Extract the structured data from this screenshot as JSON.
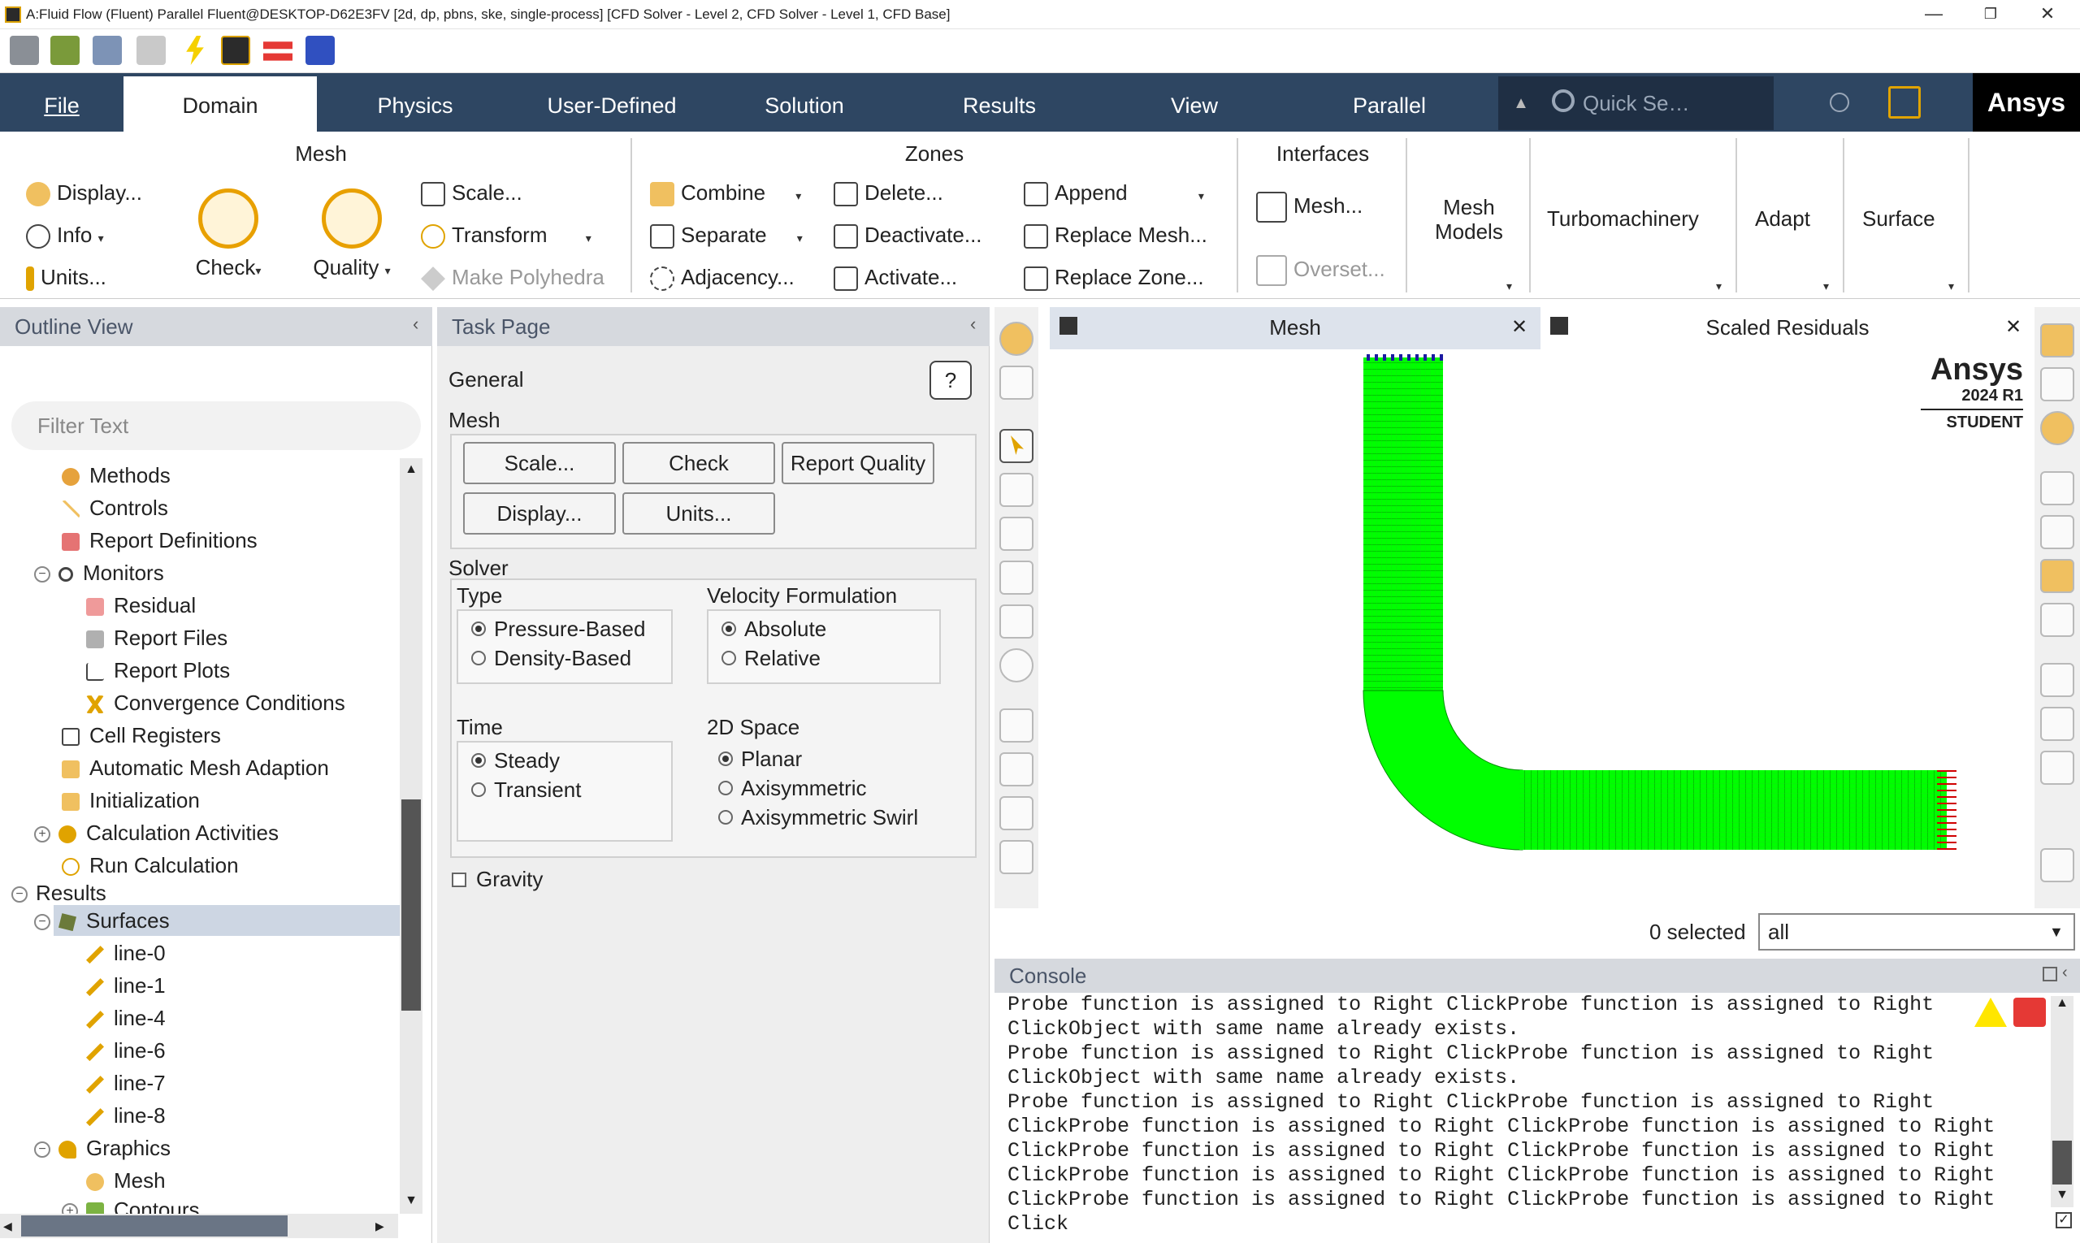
{
  "window": {
    "title": "A:Fluid Flow (Fluent) Parallel Fluent@DESKTOP-D62E3FV  [2d, dp, pbns, ske, single-process] [CFD Solver - Level 2, CFD Solver - Level 1, CFD Base]",
    "minimize": "—",
    "maximize": "❐",
    "close": "✕"
  },
  "tabs": [
    {
      "label": "File"
    },
    {
      "label": "Domain"
    },
    {
      "label": "Physics"
    },
    {
      "label": "User-Defined"
    },
    {
      "label": "Solution"
    },
    {
      "label": "Results"
    },
    {
      "label": "View"
    },
    {
      "label": "Parallel"
    }
  ],
  "quick_search": {
    "placeholder": "Quick Se…"
  },
  "brand": "Ansys",
  "ribbon": {
    "mesh": {
      "title": "Mesh",
      "display": "Display...",
      "info": "Info",
      "units": "Units...",
      "check": "Check",
      "quality": "Quality",
      "scale": "Scale...",
      "transform": "Transform",
      "make_polyhedra": "Make Polyhedra"
    },
    "zones": {
      "title": "Zones",
      "combine": "Combine",
      "separate": "Separate",
      "adjacency": "Adjacency...",
      "delete": "Delete...",
      "deactivate": "Deactivate...",
      "activate": "Activate...",
      "append": "Append",
      "replace_mesh": "Replace Mesh...",
      "replace_zone": "Replace Zone..."
    },
    "interfaces": {
      "title": "Interfaces",
      "mesh": "Mesh...",
      "overset": "Overset..."
    },
    "mesh_models": "Mesh\nModels",
    "turbomachinery": "Turbomachinery",
    "adapt": "Adapt",
    "surface": "Surface"
  },
  "outline": {
    "title": "Outline View",
    "filter_placeholder": "Filter Text",
    "items": [
      {
        "label": "Methods"
      },
      {
        "label": "Controls"
      },
      {
        "label": "Report Definitions"
      },
      {
        "label": "Monitors"
      },
      {
        "label": "Residual"
      },
      {
        "label": "Report Files"
      },
      {
        "label": "Report Plots"
      },
      {
        "label": "Convergence Conditions"
      },
      {
        "label": "Cell Registers"
      },
      {
        "label": "Automatic Mesh Adaption"
      },
      {
        "label": "Initialization"
      },
      {
        "label": "Calculation Activities"
      },
      {
        "label": "Run Calculation"
      },
      {
        "label": "Results"
      },
      {
        "label": "Surfaces"
      },
      {
        "label": "line-0"
      },
      {
        "label": "line-1"
      },
      {
        "label": "line-4"
      },
      {
        "label": "line-6"
      },
      {
        "label": "line-7"
      },
      {
        "label": "line-8"
      },
      {
        "label": "Graphics"
      },
      {
        "label": "Mesh"
      },
      {
        "label": "Contours"
      }
    ]
  },
  "task": {
    "title": "Task Page",
    "general": "General",
    "help": "?",
    "mesh_label": "Mesh",
    "buttons": {
      "scale": "Scale...",
      "check": "Check",
      "report_quality": "Report Quality",
      "display": "Display...",
      "units": "Units..."
    },
    "solver_label": "Solver",
    "type_label": "Type",
    "type_options": [
      "Pressure-Based",
      "Density-Based"
    ],
    "velocity_label": "Velocity Formulation",
    "velocity_options": [
      "Absolute",
      "Relative"
    ],
    "time_label": "Time",
    "time_options": [
      "Steady",
      "Transient"
    ],
    "space_label": "2D Space",
    "space_options": [
      "Planar",
      "Axisymmetric",
      "Axisymmetric Swirl"
    ],
    "gravity": "Gravity"
  },
  "graphics": {
    "tab_mesh": "Mesh",
    "tab_residuals": "Scaled Residuals",
    "watermark_brand": "Ansys",
    "watermark_version": "2024 R1",
    "watermark_student": "STUDENT",
    "mesh_color": "#00ff00",
    "inlet_color": "#1a1aa0",
    "outlet_color": "#d00000"
  },
  "selection": {
    "count": "0 selected",
    "filter": "all"
  },
  "console": {
    "title": "Console",
    "lines": [
      "Probe function is assigned to Right ClickProbe function is assigned to Right",
      "ClickObject with same name already exists.",
      "Probe function is assigned to Right ClickProbe function is assigned to Right",
      "ClickObject with same name already exists.",
      "Probe function is assigned to Right ClickProbe function is assigned to Right",
      "ClickProbe function is assigned to Right ClickProbe function is assigned to Right",
      "ClickProbe function is assigned to Right ClickProbe function is assigned to Right",
      "ClickProbe function is assigned to Right ClickProbe function is assigned to Right",
      "ClickProbe function is assigned to Right ClickProbe function is assigned to Right",
      "Click"
    ]
  }
}
